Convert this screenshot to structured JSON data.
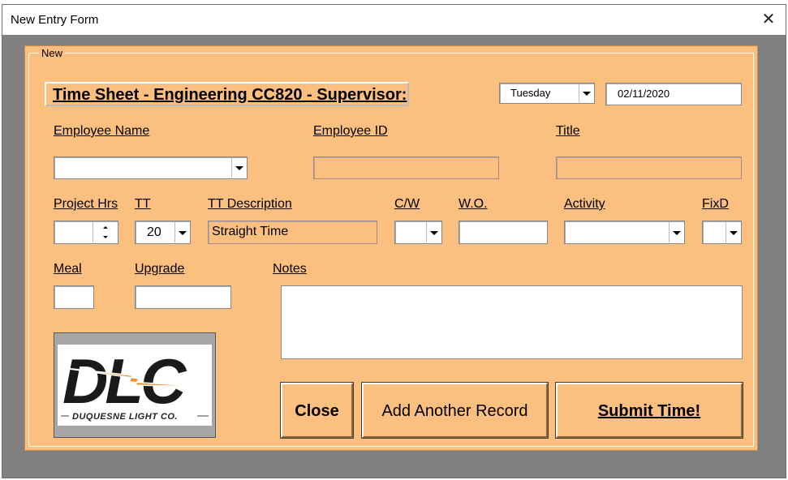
{
  "window": {
    "title": "New Entry Form",
    "close_glyph": "✕"
  },
  "group": {
    "label": "New"
  },
  "banner": {
    "text": "Time Sheet - Engineering CC820 - Supervisor:"
  },
  "header": {
    "day_value": "Tuesday",
    "date_value": "02/11/2020"
  },
  "labels": {
    "employee_name": "Employee Name",
    "employee_id": "Employee ID",
    "title": "Title",
    "project_hrs": "Project Hrs",
    "tt": "TT",
    "tt_description": "TT Description",
    "cw": "C/W",
    "wo": "W.O.",
    "activity": "Activity",
    "fixd": "FixD",
    "meal": "Meal",
    "upgrade": "Upgrade",
    "notes": "Notes"
  },
  "fields": {
    "employee_name": "",
    "employee_id": "",
    "title": "",
    "project_hrs": "",
    "tt": "20",
    "tt_description": "Straight Time",
    "cw": "",
    "wo": "",
    "activity": "",
    "fixd": "",
    "meal": "",
    "upgrade": "",
    "notes": ""
  },
  "buttons": {
    "close": "Close",
    "add_another": "Add Another Record",
    "submit": "Submit Time!"
  },
  "logo": {
    "letters": "DLC",
    "company": "DUQUESNE LIGHT CO."
  },
  "colors": {
    "form_bg": "#fbbf80",
    "window_bg": "#808080",
    "logo_orange": "#f08c1e"
  },
  "icons": [
    "close-icon",
    "chevron-down-icon",
    "spin-up-icon",
    "spin-down-icon",
    "lightning-bolt-icon"
  ]
}
